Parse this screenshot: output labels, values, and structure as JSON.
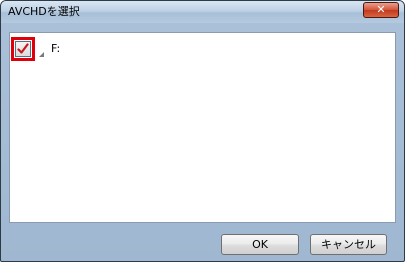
{
  "window": {
    "title": "AVCHDを選択",
    "close_glyph": "✕"
  },
  "tree": {
    "items": [
      {
        "label": "F:",
        "checked": true
      }
    ]
  },
  "buttons": {
    "ok_label": "OK",
    "cancel_label": "キャンセル"
  },
  "colors": {
    "highlight": "#e0000a",
    "checkmark": "#c8181e",
    "close_button": "#c9452a"
  },
  "icons": {
    "checkbox": "checkmark-icon",
    "expander": "expand-arrow-icon",
    "close": "close-icon"
  }
}
